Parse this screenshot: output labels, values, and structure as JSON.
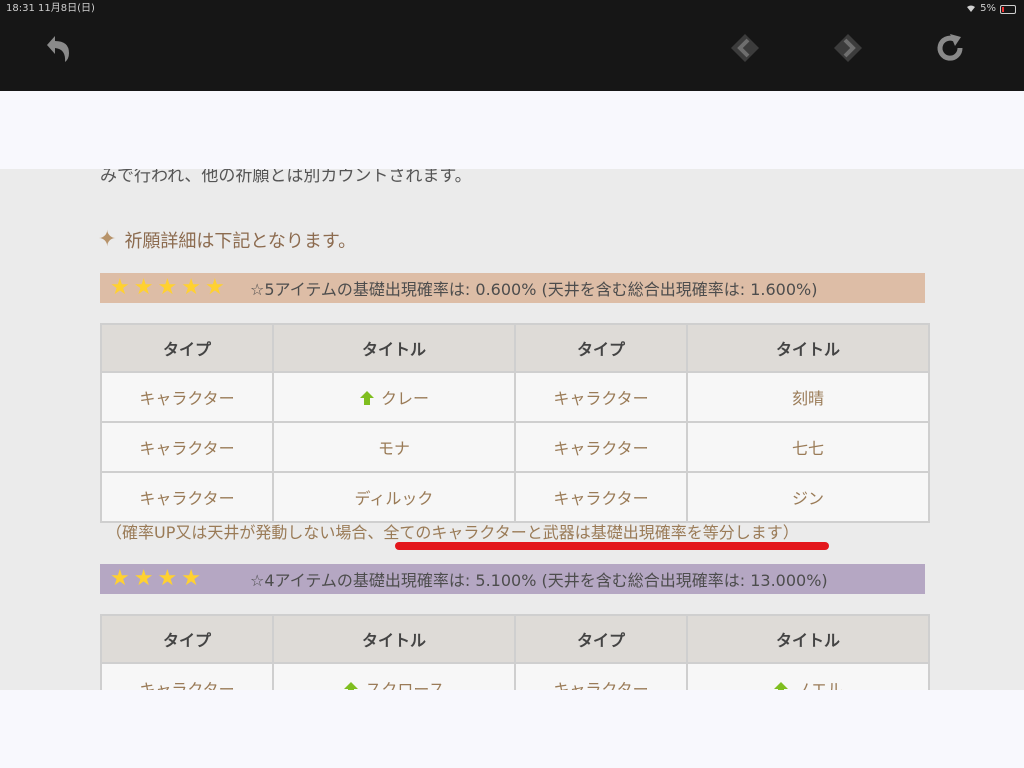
{
  "status_bar": {
    "time": "18:31",
    "date": "11月8日(日)",
    "battery": "5%"
  },
  "toolbar": {
    "back_icon": "undo-arrow-icon",
    "prev_icon": "diamond-left-icon",
    "next_icon": "diamond-right-icon",
    "reload_icon": "reload-icon"
  },
  "page": {
    "cut_text": "みで行われ、他の祈願とは別カウントされます。",
    "heading": "祈願詳細は下記となります。",
    "five_star": {
      "stars": "★★★★★",
      "rate_text": "☆5アイテムの基礎出現確率は: 0.600% (天井を含む総合出現確率は: 1.600%)",
      "headers": [
        "タイプ",
        "タイトル",
        "タイプ",
        "タイトル"
      ],
      "rows": [
        {
          "type1": "キャラクター",
          "title1": "クレー",
          "type2": "キャラクター",
          "title2": "刻晴"
        },
        {
          "type1": "キャラクター",
          "title1": "モナ",
          "type2": "キャラクター",
          "title2": "七七"
        },
        {
          "type1": "キャラクター",
          "title1": "ディルック",
          "type2": "キャラクター",
          "title2": "ジン"
        }
      ]
    },
    "note_prefix": "（確率UP又は天井が発動しない場合、",
    "note_highlight": "全てのキャラクターと武器は基礎出現確率を等分します）",
    "four_star": {
      "stars": "★★★★",
      "rate_text": "☆4アイテムの基礎出現確率は: 5.100% (天井を含む総合出現確率は: 13.000%)",
      "headers": [
        "タイプ",
        "タイトル",
        "タイプ",
        "タイトル"
      ],
      "rows": [
        {
          "type1": "キャラクター",
          "title1": "スクロース",
          "type2": "キャラクター",
          "title2": "ノエル"
        }
      ]
    }
  },
  "colors": {
    "five_star_banner": "#ddbda6",
    "four_star_banner": "#b5a7c3",
    "star": "#ffd130",
    "up_arrow": "#7fbe1f",
    "underline": "#e3161b",
    "cell_text": "#9a7b57"
  }
}
